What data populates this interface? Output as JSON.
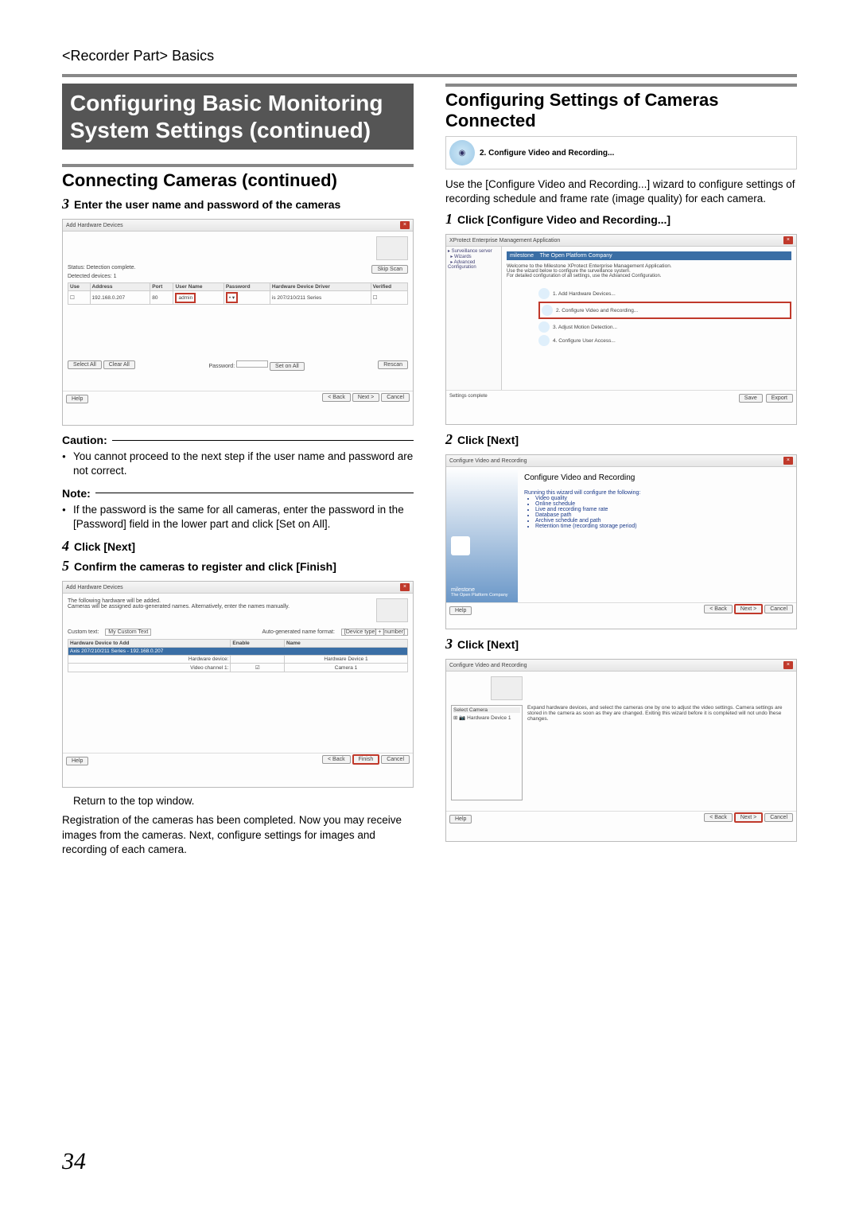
{
  "breadcrumb": "<Recorder Part> Basics",
  "page_number": "34",
  "left": {
    "main_title": "Configuring Basic Monitoring System Settings (continued)",
    "section_title": "Connecting Cameras (continued)",
    "step3_num": "3",
    "step3_text": "Enter the user name and password of the cameras",
    "shot1": {
      "title": "Add Hardware Devices",
      "status_label": "Status:",
      "status_value": "Detection complete.",
      "detected_label": "Detected devices:",
      "detected_value": "1",
      "skip_btn": "Skip Scan",
      "cols": {
        "use": "Use",
        "address": "Address",
        "port": "Port",
        "user": "User Name",
        "pass": "Password",
        "driver": "Hardware Device Driver",
        "verified": "Verified"
      },
      "row": {
        "address": "192.168.0.207",
        "port": "80",
        "user": "admin",
        "driver": "is 207/210/211 Series"
      },
      "select_all": "Select All",
      "clear_all": "Clear All",
      "password_label": "Password:",
      "set_on_all": "Set on All",
      "rescan": "Rescan",
      "help": "Help",
      "back": "< Back",
      "next": "Next >",
      "cancel": "Cancel"
    },
    "caution_label": "Caution:",
    "caution_bullet": "You cannot proceed to the next step if the user name and password are not correct.",
    "note_label": "Note:",
    "note_bullet": "If the password is the same for all cameras, enter the password in the [Password] field in the lower part and click [Set on All].",
    "step4_num": "4",
    "step4_text": "Click [Next]",
    "step5_num": "5",
    "step5_text": "Confirm the cameras to register and click [Finish]",
    "shot2": {
      "title": "Add Hardware Devices",
      "intro1": "The following hardware will be added.",
      "intro2": "Cameras will be assigned auto-generated names. Alternatively, enter the names manually.",
      "custom_text_label": "Custom text:",
      "custom_text_value": "My Custom Text",
      "auto_label": "Auto-generated name format:",
      "auto_value": "[Device type] + [number]",
      "col_device": "Hardware Device to Add",
      "col_enable": "Enable",
      "col_name": "Name",
      "row_hw_label": "Hardware device:",
      "row_hw_name": "Hardware Device 1",
      "row_ch_label": "Video channel 1:",
      "row_ch_name": "Camera 1",
      "help": "Help",
      "back": "< Back",
      "finish": "Finish",
      "cancel": "Cancel"
    },
    "return_text": "Return to the top window.",
    "closing_para": "Registration of the cameras has been completed. Now you may receive images from the cameras. Next, configure settings for images and recording of each camera."
  },
  "right": {
    "section_title": "Configuring Settings of Cameras Connected",
    "wizard_label": "2. Configure Video and Recording...",
    "intro_para": "Use the [Configure Video and Recording...] wizard to configure settings of recording schedule and frame rate (image quality) for each camera.",
    "step1_num": "1",
    "step1_text": "Click [Configure Video and Recording...]",
    "shot3": {
      "title": "XProtect Enterprise Management Application",
      "welcome": "Welcome to the Milestone XProtect Enterprise Management Application.",
      "sub1": "Use the wizard below to configure the surveillance system.",
      "sub2": "For detailed configuration of all settings, use the Advanced Configuration.",
      "item1": "1. Add Hardware Devices...",
      "item2": "2. Configure Video and Recording...",
      "item3": "3. Adjust Motion Detection...",
      "item4": "4. Configure User Access...",
      "footer_left": "Settings complete",
      "footer_btn1": "Save",
      "footer_btn2": "Export"
    },
    "step2_num": "2",
    "step2_text": "Click [Next]",
    "shot4": {
      "title": "Configure Video and Recording",
      "heading": "Configure Video and Recording",
      "lead": "Running this wizard will configure the following:",
      "b1": "Video quality",
      "b2": "Online schedule",
      "b3": "Live and recording frame rate",
      "b4": "Database path",
      "b5": "Archive schedule and path",
      "b6": "Retention time (recording storage period)",
      "brand": "milestone",
      "tagline": "The Open Platform Company",
      "help": "Help",
      "back": "< Back",
      "next": "Next >",
      "cancel": "Cancel"
    },
    "step3_num": "3",
    "step3_text": "Click [Next]",
    "shot5": {
      "title": "Configure Video and Recording",
      "panel_title": "Select Camera",
      "tree_item": "Hardware Device 1",
      "desc": "Expand hardware devices, and select the cameras one by one to adjust the video settings. Camera settings are stored in the camera as soon as they are changed. Exiting this wizard before it is completed will not undo these changes.",
      "help": "Help",
      "back": "< Back",
      "next": "Next >",
      "cancel": "Cancel"
    }
  }
}
